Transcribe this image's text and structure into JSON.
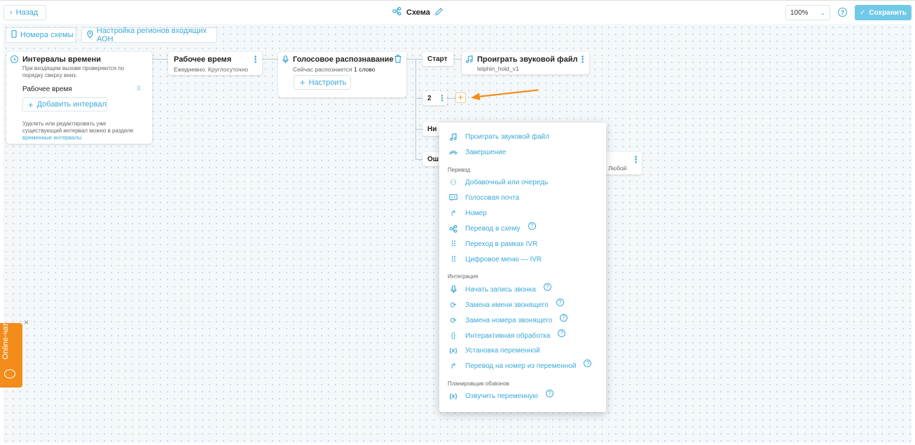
{
  "header": {
    "back_label": "Назад",
    "scheme_title": "Схема",
    "zoom": "100%",
    "save_label": "Сохранить"
  },
  "toolbar": {
    "numbers_label": "Номера схемы",
    "regions_label": "Настройка регионов входящих АОН"
  },
  "intervals_card": {
    "title": "Интервалы времени",
    "description": "При входящем вызове проверяются по порядку сверху вниз.",
    "item": "Рабочее время",
    "add_label": "Добавить интервал",
    "note": "Удалить или редактировать уже существующий интервал можно в разделе",
    "note_link": "временные интервалы"
  },
  "work_card": {
    "title": "Рабочее время",
    "subtitle": "Ежедневно. Круглосуточно"
  },
  "voice_card": {
    "title": "Голосовое распознавание",
    "subtitle_prefix": "Сейчас распознается",
    "subtitle_count": "1 слово",
    "configure_label": "Настроить"
  },
  "branches": {
    "start": "Старт",
    "two": "2",
    "nothing": "Ни",
    "error": "Ош"
  },
  "play_card": {
    "title": "Проиграть звуковой файл",
    "subtitle": "telphin_hold_v1"
  },
  "partial_card": {
    "text": "Любой"
  },
  "menu": {
    "top_items": [
      {
        "label": "Проиграть звуковой файл",
        "icon": "music-icon"
      },
      {
        "label": "Завершение",
        "icon": "hangup-icon"
      }
    ],
    "sections": [
      {
        "header": "Перевод",
        "items": [
          {
            "label": "Добавочный или очередь",
            "icon": "users-icon",
            "help": false
          },
          {
            "label": "Голосовая почта",
            "icon": "voicemail-icon",
            "help": false
          },
          {
            "label": "Номер",
            "icon": "forward-icon",
            "help": false
          },
          {
            "label": "Перевод в схему",
            "icon": "scheme-icon",
            "help": true
          },
          {
            "label": "Переход в рамках IVR",
            "icon": "keypad-pointer-icon",
            "help": false
          },
          {
            "label": "Цифровое меню — IVR",
            "icon": "keypad-icon",
            "help": false
          }
        ]
      },
      {
        "header": "Интеграция",
        "items": [
          {
            "label": "Начать запись звонка",
            "icon": "microphone-icon",
            "help": true
          },
          {
            "label": "Замена имени звонящего",
            "icon": "swap-icon",
            "help": true
          },
          {
            "label": "Замена номера звонящего",
            "icon": "swap-icon",
            "help": true
          },
          {
            "label": "Интерактивная обработка",
            "icon": "braces-icon",
            "help": true
          },
          {
            "label": "Установка переменной",
            "icon": "variable-icon",
            "help": false
          },
          {
            "label": "Перевод на номер из переменной",
            "icon": "forward-icon",
            "help": true
          }
        ]
      },
      {
        "header": "Планировщик обзвонов",
        "items": [
          {
            "label": "Озвучить переменную",
            "icon": "variable-icon",
            "help": true
          }
        ]
      }
    ]
  },
  "chat_widget": {
    "label": "Online-чат",
    "close": "×"
  },
  "colors": {
    "accent": "#3aa9d8",
    "save_bg": "#71c9e8",
    "orange": "#f28c1b"
  }
}
